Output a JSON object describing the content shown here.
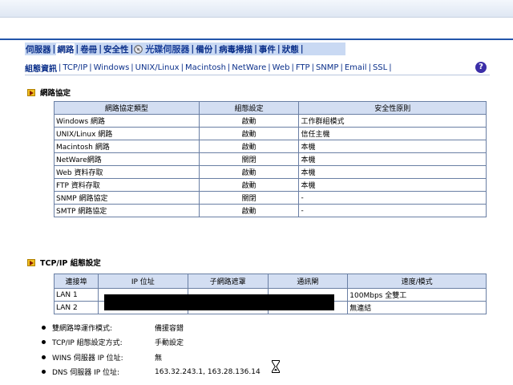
{
  "nav": {
    "tabs": [
      {
        "label": "伺服器",
        "active": false
      },
      {
        "label": "網路",
        "active": true
      },
      {
        "label": "卷冊",
        "active": false
      },
      {
        "label": "安全性",
        "active": false
      },
      {
        "label": "光碟伺服器",
        "active": false,
        "icon": "disc-server-icon"
      },
      {
        "label": "備份",
        "active": false
      },
      {
        "label": "病毒掃描",
        "active": false
      },
      {
        "label": "事件",
        "active": false
      },
      {
        "label": "狀態",
        "active": false
      }
    ],
    "subtabs": [
      {
        "label": "組態資訊",
        "active": true
      },
      {
        "label": "TCP/IP",
        "active": false
      },
      {
        "label": "Windows",
        "active": false
      },
      {
        "label": "UNIX/Linux",
        "active": false
      },
      {
        "label": "Macintosh",
        "active": false
      },
      {
        "label": "NetWare",
        "active": false
      },
      {
        "label": "Web",
        "active": false
      },
      {
        "label": "FTP",
        "active": false
      },
      {
        "label": "SNMP",
        "active": false
      },
      {
        "label": "Email",
        "active": false
      },
      {
        "label": "SSL",
        "active": false
      }
    ],
    "help_icon": "?"
  },
  "protocols": {
    "title": "網路協定",
    "headers": [
      "網路協定類型",
      "組態設定",
      "安全性原則"
    ],
    "rows": [
      [
        "Windows 網路",
        "啟動",
        "工作群組模式"
      ],
      [
        "UNIX/Linux 網路",
        "啟動",
        "信任主機"
      ],
      [
        "Macintosh 網路",
        "啟動",
        "本機"
      ],
      [
        "NetWare網路",
        "關閉",
        "本機"
      ],
      [
        "Web 資料存取",
        "啟動",
        "本機"
      ],
      [
        "FTP 資料存取",
        "啟動",
        "本機"
      ],
      [
        "SNMP 網路協定",
        "關閉",
        "-"
      ],
      [
        "SMTP 網路協定",
        "啟動",
        "-"
      ]
    ]
  },
  "tcpip": {
    "title": "TCP/IP 組態設定",
    "headers": [
      "連接埠",
      "IP 位址",
      "子網路遮罩",
      "通訊閘",
      "速度/模式"
    ],
    "rows": [
      [
        "LAN 1",
        "",
        "",
        "",
        "100Mbps 全雙工"
      ],
      [
        "LAN 2",
        "",
        "",
        "",
        "無連結"
      ]
    ],
    "details": [
      {
        "label": "雙網路埠運作模式:",
        "value": "備援容錯"
      },
      {
        "label": "TCP/IP 組態設定方式:",
        "value": "手動設定"
      },
      {
        "label": "WINS 伺服器 IP 位址:",
        "value": "無"
      },
      {
        "label": "DNS 伺服器 IP 位址:",
        "value": "163.32.243.1, 163.28.136.14"
      }
    ]
  }
}
